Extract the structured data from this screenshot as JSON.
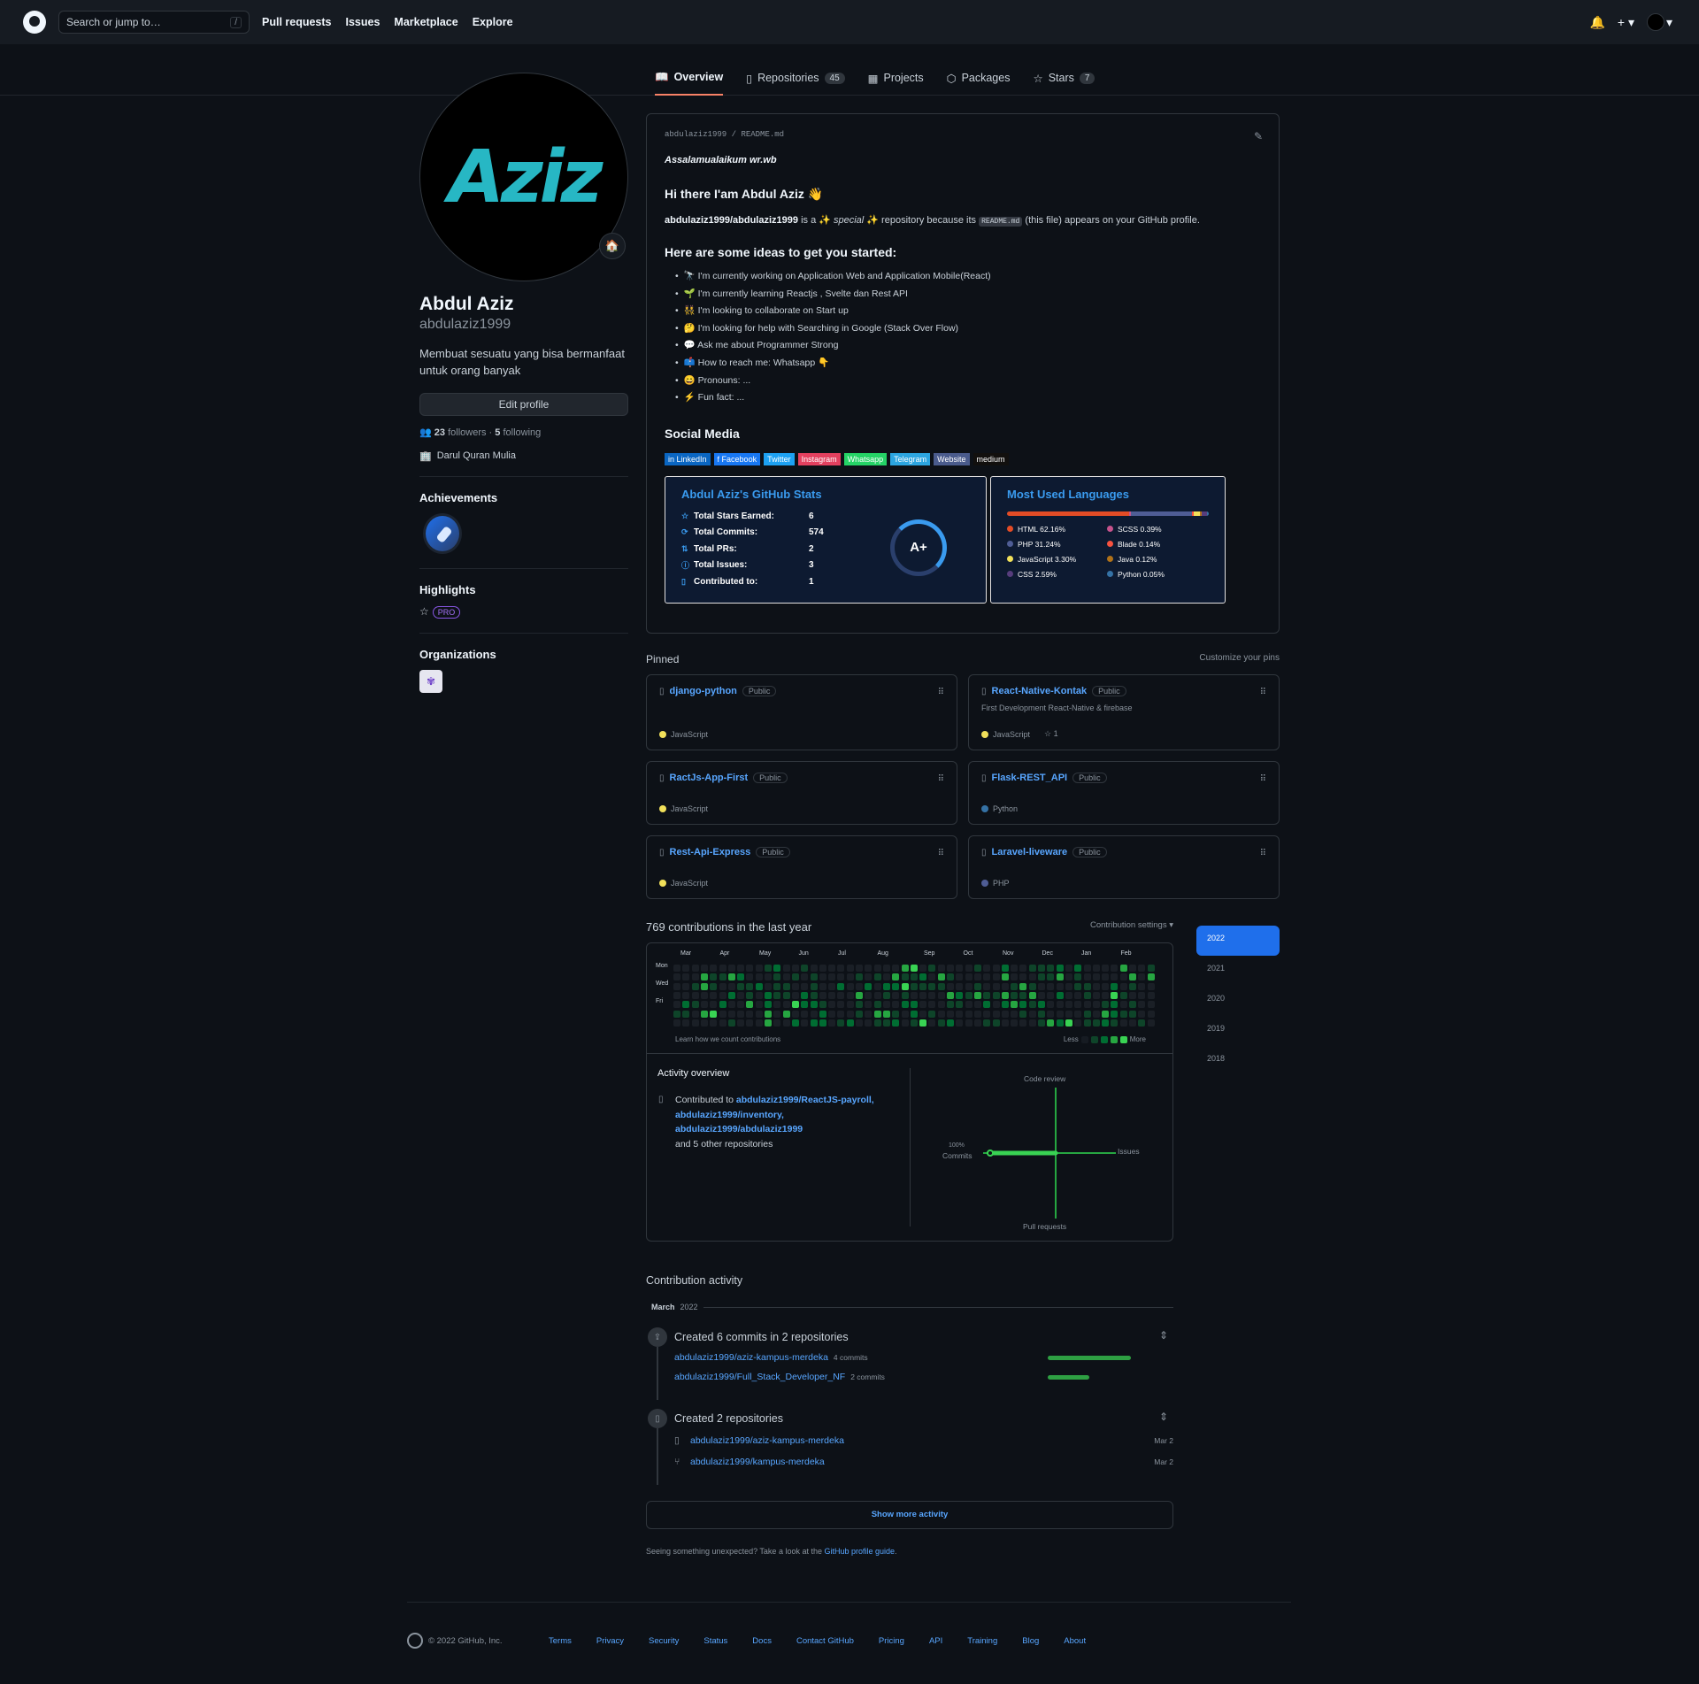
{
  "header": {
    "search_placeholder": "Search or jump to…",
    "slash": "/",
    "nav": [
      "Pull requests",
      "Issues",
      "Marketplace",
      "Explore"
    ]
  },
  "tabs": [
    {
      "label": "Overview",
      "count": ""
    },
    {
      "label": "Repositories",
      "count": "45"
    },
    {
      "label": "Projects",
      "count": ""
    },
    {
      "label": "Packages",
      "count": ""
    },
    {
      "label": "Stars",
      "count": "7"
    }
  ],
  "profile": {
    "avatar_text": "Aziz",
    "status_emoji": "🏠",
    "name": "Abdul Aziz",
    "login": "abdulaziz1999",
    "bio": "Membuat sesuatu yang bisa bermanfaat untuk orang banyak",
    "edit_button": "Edit profile",
    "followers": "23",
    "followers_label": "followers",
    "following": "5",
    "following_label": "following",
    "dot": "·",
    "company": "Darul Quran Mulia",
    "achievements_title": "Achievements",
    "highlights_title": "Highlights",
    "pro_label": "PRO",
    "organizations_title": "Organizations"
  },
  "readme": {
    "path_user": "abdulaziz1999",
    "path_sep": "/",
    "path_file": "README.md",
    "greeting": "Assalamualaikum wr.wb",
    "hi": "Hi there I'am Abdul Aziz 👋",
    "intro_repo": "abdulaziz1999/abdulaziz1999",
    "intro_a": " is a ✨ ",
    "intro_special": "special",
    "intro_b": " ✨ repository because its ",
    "intro_code": "README.md",
    "intro_c": " (this file) appears on your GitHub profile.",
    "ideas_title": "Here are some ideas to get you started:",
    "ideas": [
      "🔭 I'm currently working on Application Web and Application Mobile(React)",
      "🌱 I'm currently learning Reactjs , Svelte dan Rest API",
      "👯 I'm looking to collaborate on Start up",
      "🤔 I'm looking for help with Searching in Google (Stack Over Flow)",
      "💬 Ask me about Programmer Strong",
      "📫 How to reach me: Whatsapp 👇",
      "😄 Pronouns: ...",
      "⚡ Fun fact: ..."
    ],
    "social_title": "Social Media",
    "socials": [
      {
        "label": "in LinkedIn",
        "color": "#0a66c2"
      },
      {
        "label": "f Facebook",
        "color": "#1877f2"
      },
      {
        "label": "Twitter",
        "color": "#1da1f2"
      },
      {
        "label": "Instagram",
        "color": "#e4405f"
      },
      {
        "label": "Whatsapp",
        "color": "#25d366"
      },
      {
        "label": "Telegram",
        "color": "#2ca5e0"
      },
      {
        "label": "Website",
        "color": "#4a5b8c"
      },
      {
        "label": "medium",
        "color": "#12100e"
      }
    ]
  },
  "stats": {
    "title": "Abdul Aziz's GitHub Stats",
    "rows": [
      {
        "k": "Total Stars Earned:",
        "v": "6"
      },
      {
        "k": "Total Commits:",
        "v": "574"
      },
      {
        "k": "Total PRs:",
        "v": "2"
      },
      {
        "k": "Total Issues:",
        "v": "3"
      },
      {
        "k": "Contributed to:",
        "v": "1"
      }
    ],
    "grade": "A+"
  },
  "languages": {
    "title": "Most Used Languages",
    "items": [
      {
        "name": "HTML 62.16%",
        "pct": 62.16,
        "color": "#e34c26"
      },
      {
        "name": "SCSS 0.39%",
        "pct": 0.39,
        "color": "#c6538c"
      },
      {
        "name": "PHP 31.24%",
        "pct": 31.24,
        "color": "#4f5d95"
      },
      {
        "name": "Blade 0.14%",
        "pct": 0.14,
        "color": "#f7523f"
      },
      {
        "name": "JavaScript 3.30%",
        "pct": 3.3,
        "color": "#f1e05a"
      },
      {
        "name": "Java 0.12%",
        "pct": 0.12,
        "color": "#b07219"
      },
      {
        "name": "CSS 2.59%",
        "pct": 2.59,
        "color": "#563d7c"
      },
      {
        "name": "Python 0.05%",
        "pct": 0.05,
        "color": "#3572a5"
      }
    ]
  },
  "pinned": {
    "title": "Pinned",
    "customize": "Customize your pins",
    "public_label": "Public",
    "items": [
      {
        "name": "django-python",
        "desc": "",
        "lang": "JavaScript",
        "lang_color": "#f1e05a",
        "stars": ""
      },
      {
        "name": "React-Native-Kontak",
        "desc": "First Development React-Native & firebase",
        "lang": "JavaScript",
        "lang_color": "#f1e05a",
        "stars": "1"
      },
      {
        "name": "RactJs-App-First",
        "desc": "",
        "lang": "JavaScript",
        "lang_color": "#f1e05a",
        "stars": ""
      },
      {
        "name": "Flask-REST_API",
        "desc": "",
        "lang": "Python",
        "lang_color": "#3572a5",
        "stars": ""
      },
      {
        "name": "Rest-Api-Express",
        "desc": "",
        "lang": "JavaScript",
        "lang_color": "#f1e05a",
        "stars": ""
      },
      {
        "name": "Laravel-liveware",
        "desc": "",
        "lang": "PHP",
        "lang_color": "#4f5d95",
        "stars": ""
      }
    ]
  },
  "contributions": {
    "title": "769 contributions in the last year",
    "settings": "Contribution settings ▾",
    "months": [
      "Mar",
      "Apr",
      "May",
      "Jun",
      "Jul",
      "Aug",
      "Sep",
      "Oct",
      "Nov",
      "Dec",
      "Jan",
      "Feb"
    ],
    "days": [
      "Mon",
      "Wed",
      "Fri"
    ],
    "learn": "Learn how we count contributions",
    "less": "Less",
    "more": "More",
    "colors": [
      "#161b22",
      "#0e4429",
      "#006d32",
      "#26a641",
      "#39d353"
    ]
  },
  "activity": {
    "title": "Activity overview",
    "contributed_to": "Contributed to",
    "repos": [
      "abdulaziz1999/ReactJS-payroll,",
      "abdulaziz1999/inventory,",
      "abdulaziz1999/abdulaziz1999"
    ],
    "others": "and 5 other repositories",
    "axis": {
      "top": "Code review",
      "bottom": "Pull requests",
      "left_pct": "100%",
      "left": "Commits",
      "right": "Issues"
    },
    "commits_pct": 100
  },
  "years": [
    "2022",
    "2021",
    "2020",
    "2019",
    "2018"
  ],
  "contribution_activity": {
    "title": "Contribution activity",
    "month": "March",
    "year": "2022",
    "commits_title": "Created 6 commits in 2 repositories",
    "commit_repos": [
      {
        "name": "abdulaziz1999/aziz-kampus-merdeka",
        "count": "4 commits",
        "n": 4
      },
      {
        "name": "abdulaziz1999/Full_Stack_Developer_NF",
        "count": "2 commits",
        "n": 2
      }
    ],
    "repos_title": "Created 2 repositories",
    "created": [
      {
        "name": "abdulaziz1999/aziz-kampus-merdeka",
        "date": "Mar 2"
      },
      {
        "name": "abdulaziz1999/kampus-merdeka",
        "date": "Mar 2"
      }
    ],
    "show_more": "Show more activity",
    "hint_a": "Seeing something unexpected? Take a look at the ",
    "hint_link": "GitHub profile guide",
    "hint_b": "."
  },
  "footer": {
    "copyright": "© 2022 GitHub, Inc.",
    "links": [
      "Terms",
      "Privacy",
      "Security",
      "Status",
      "Docs",
      "Contact GitHub",
      "Pricing",
      "API",
      "Training",
      "Blog",
      "About"
    ]
  }
}
